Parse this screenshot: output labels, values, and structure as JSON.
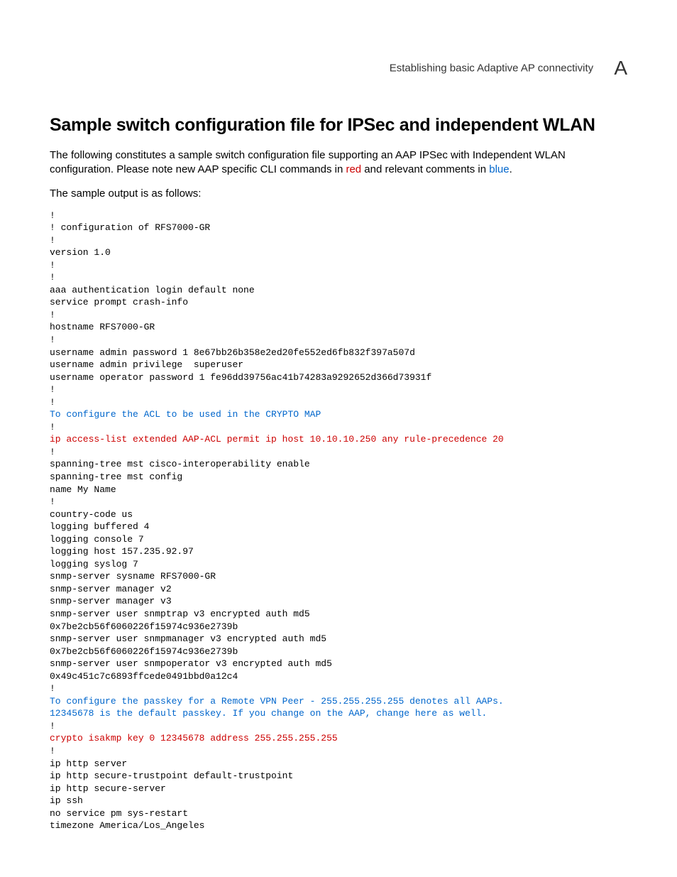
{
  "header": {
    "breadcrumb": "Establishing basic Adaptive AP connectivity",
    "appendix": "A"
  },
  "title": "Sample switch configuration file for IPSec and independent WLAN",
  "intro": {
    "pre": "The following constitutes a sample switch configuration file supporting an AAP IPSec with Independent WLAN configuration. Please note new AAP specific CLI commands in ",
    "red_word": "red",
    "mid": " and relevant comments in ",
    "blue_word": "blue",
    "post": "."
  },
  "lead": "The sample output is as follows:",
  "code": {
    "block1": "!\n! configuration of RFS7000-GR\n!\nversion 1.0\n!\n!\naaa authentication login default none\nservice prompt crash-info\n!\nhostname RFS7000-GR\n!\nusername admin password 1 8e67bb26b358e2ed20fe552ed6fb832f397a507d\nusername admin privilege  superuser\nusername operator password 1 fe96dd39756ac41b74283a9292652d366d73931f\n!\n!",
    "comment1": "To configure the ACL to be used in the CRYPTO MAP",
    "block2": "!",
    "red1": "ip access-list extended AAP-ACL permit ip host 10.10.10.250 any rule-precedence 20",
    "block3": "!\nspanning-tree mst cisco-interoperability enable\nspanning-tree mst config\nname My Name\n!\ncountry-code us\nlogging buffered 4\nlogging console 7\nlogging host 157.235.92.97\nlogging syslog 7\nsnmp-server sysname RFS7000-GR\nsnmp-server manager v2\nsnmp-server manager v3\nsnmp-server user snmptrap v3 encrypted auth md5\n0x7be2cb56f6060226f15974c936e2739b\nsnmp-server user snmpmanager v3 encrypted auth md5\n0x7be2cb56f6060226f15974c936e2739b\nsnmp-server user snmpoperator v3 encrypted auth md5\n0x49c451c7c6893ffcede0491bbd0a12c4\n!",
    "comment2": "To configure the passkey for a Remote VPN Peer - 255.255.255.255 denotes all AAPs.\n12345678 is the default passkey. If you change on the AAP, change here as well.",
    "block4": "!",
    "red2": "crypto isakmp key 0 12345678 address 255.255.255.255",
    "block5": "!\nip http server\nip http secure-trustpoint default-trustpoint\nip http secure-server\nip ssh\nno service pm sys-restart\ntimezone America/Los_Angeles"
  }
}
